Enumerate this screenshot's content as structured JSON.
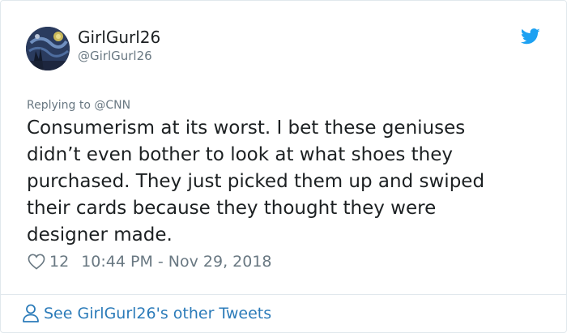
{
  "user": {
    "display_name": "GirlGurl26",
    "handle": "@GirlGurl26",
    "avatar_icon": "starry-night-avatar"
  },
  "brand": {
    "icon": "twitter-bird-icon",
    "color": "#1da1f2"
  },
  "tweet": {
    "replying_prefix": "Replying to ",
    "replying_to": "@CNN",
    "text": "Consumerism at its worst. I bet these geniuses\ndidn’t even bother to look at what shoes they\npurchased. They just picked them up and swiped\ntheir cards because they thought they were\ndesigner made.",
    "like_count": "12",
    "timestamp": "10:44 PM - Nov 29, 2018"
  },
  "footer": {
    "link_text": "See GirlGurl26's other Tweets",
    "icon": "person-icon",
    "link_color": "#2b7bb9"
  }
}
